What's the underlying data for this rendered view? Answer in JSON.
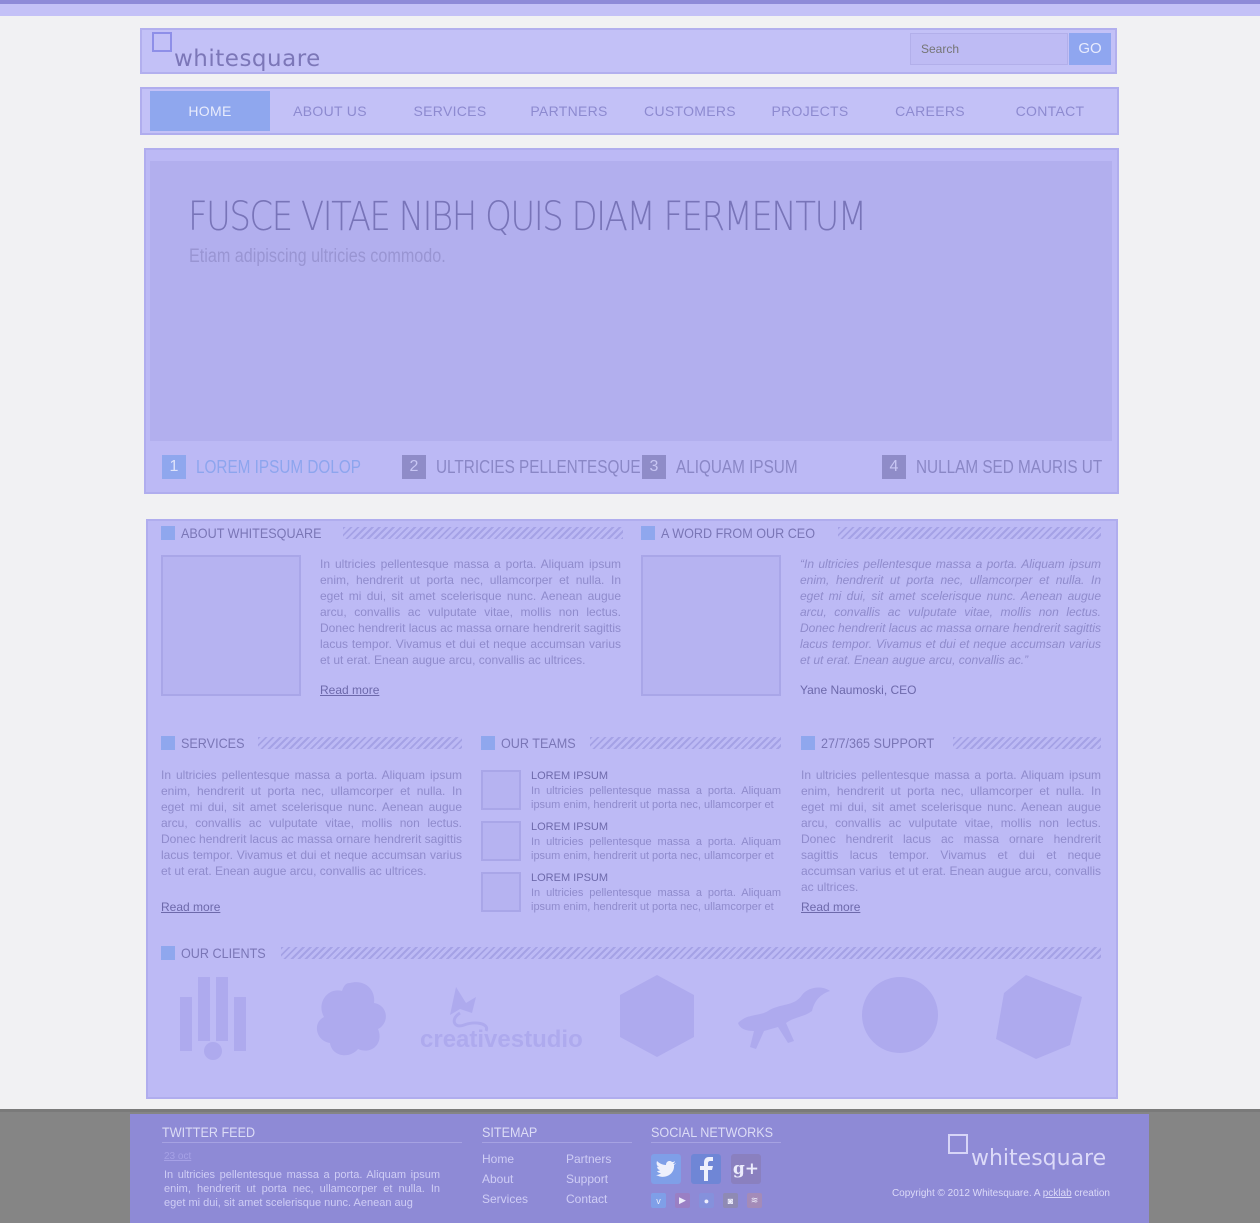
{
  "brand": {
    "name": "whitesquare"
  },
  "search": {
    "placeholder": "Search",
    "button": "GO"
  },
  "nav": {
    "items": [
      "HOME",
      "ABOUT US",
      "SERVICES",
      "PARTNERS",
      "CUSTOMERS",
      "PROJECTS",
      "CAREERS",
      "CONTACT"
    ],
    "active": "HOME"
  },
  "slider": {
    "title": "FUSCE VITAE NIBH QUIS DIAM FERMENTUM",
    "subtitle": "Etiam adipiscing ultricies commodo.",
    "tabs": [
      {
        "num": "1",
        "label": "LOREM IPSUM DOLOP"
      },
      {
        "num": "2",
        "label": "ULTRICIES PELLENTESQUE"
      },
      {
        "num": "3",
        "label": "ALIQUAM IPSUM"
      },
      {
        "num": "4",
        "label": "NULLAM SED MAURIS UT"
      }
    ]
  },
  "about": {
    "title": "ABOUT WHITESQUARE",
    "text": "In ultricies pellentesque massa a porta. Aliquam ipsum enim, hendrerit ut porta nec, ullamcorper et nulla. In eget mi dui, sit amet scelerisque nunc. Aenean augue arcu, convallis ac vulputate vitae, mollis non lectus. Donec hendrerit lacus ac massa ornare hendrerit sagittis lacus tempor. Vivamus et dui et neque accumsan varius et ut erat. Enean augue arcu, convallis ac ultrices.",
    "link": "Read more"
  },
  "ceo": {
    "title": "A WORD FROM OUR CEO",
    "quote": "“In ultricies pellentesque massa a porta. Aliquam ipsum enim, hendrerit ut porta nec, ullamcorper et nulla. In eget mi dui, sit amet scelerisque nunc. Aenean augue arcu, convallis ac vulputate vitae, mollis non lectus. Donec hendrerit lacus ac massa ornare hendrerit sagittis lacus tempor. Vivamus et dui et neque accumsan varius et ut erat. Enean augue arcu, convallis ac.”",
    "name": "Yane Naumoski, CEO"
  },
  "services": {
    "title": "SERVICES",
    "text": "In ultricies pellentesque massa a porta. Aliquam ipsum enim, hendrerit ut porta nec, ullamcorper et nulla. In eget mi dui, sit amet scelerisque nunc. Aenean augue arcu, convallis ac vulputate vitae, mollis non lectus. Donec hendrerit lacus ac massa ornare hendrerit sagittis lacus tempor. Vivamus et dui et neque accumsan varius et ut erat. Enean augue arcu, convallis ac ultrices.",
    "link": "Read more"
  },
  "teams": {
    "title": "OUR TEAMS",
    "items": [
      {
        "name": "LOREM IPSUM",
        "text": "In ultricies pellentesque massa a porta. Aliquam ipsum enim, hendrerit ut porta nec, ullamcorper et"
      },
      {
        "name": "LOREM IPSUM",
        "text": "In ultricies pellentesque massa a porta. Aliquam ipsum enim, hendrerit ut porta nec, ullamcorper et"
      },
      {
        "name": "LOREM IPSUM",
        "text": "In ultricies pellentesque massa a porta. Aliquam ipsum enim, hendrerit ut porta nec, ullamcorper et"
      }
    ]
  },
  "support": {
    "title": "27/7/365 SUPPORT",
    "text": "In ultricies pellentesque massa a porta. Aliquam ipsum enim, hendrerit ut porta nec, ullamcorper et nulla. In eget mi dui, sit amet scelerisque nunc. Aenean augue arcu, convallis ac vulputate vitae, mollis non lectus. Donec hendrerit lacus ac massa ornare hendrerit sagittis lacus tempor. Vivamus et dui et neque accumsan varius et ut erat. Enean augue arcu, convallis ac ultrices.",
    "link": "Read more"
  },
  "clients": {
    "title": "OUR CLIENTS",
    "logo_text": "creativestudio",
    "logos": [
      "bars-logo-icon",
      "flower-logo-icon",
      "creativestudio-logo-icon",
      "hexagon-logo-icon",
      "horse-logo-icon",
      "circle-logo-icon",
      "diamond-logo-icon"
    ]
  },
  "footer": {
    "twitter": {
      "title": "TWITTER FEED",
      "date": "23 oct",
      "text": "In ultricies pellentesque massa a porta. Aliquam ipsum enim, hendrerit ut porta nec, ullamcorper et nulla. In eget mi dui, sit amet scelerisque nunc. Aenean aug"
    },
    "sitemap": {
      "title": "SITEMAP",
      "col1": [
        "Home",
        "About",
        "Services"
      ],
      "col2": [
        "Partners",
        "Support",
        "Contact"
      ]
    },
    "social": {
      "title": "SOCIAL NETWORKS",
      "big": [
        "twitter-icon",
        "facebook-icon",
        "google-plus-icon"
      ],
      "small": [
        "vimeo-icon",
        "youtube-icon",
        "flickr-icon",
        "instagram-icon",
        "rss-icon"
      ]
    },
    "logo": "whitesquare",
    "copyright_prefix": "Copyright © 2012 Whitesquare. A ",
    "copyright_link": "pcklab",
    "copyright_suffix": " creation"
  },
  "colors": {
    "accent": "#8fa7ee",
    "panel": "#bdbaf5",
    "footer": "#8e8ad6",
    "text": "#8f8bcc"
  }
}
